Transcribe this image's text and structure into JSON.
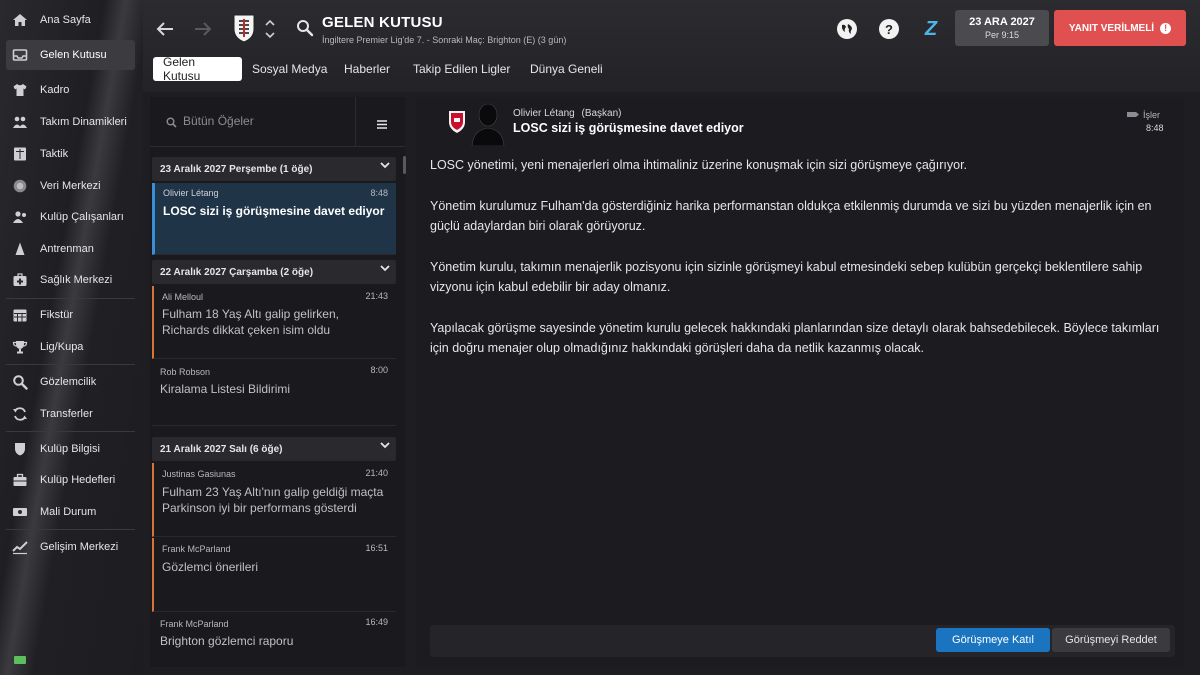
{
  "sidebar": {
    "items": [
      {
        "label": "Ana Sayfa",
        "icon": "home-icon"
      },
      {
        "label": "Gelen Kutusu",
        "icon": "inbox-icon"
      },
      {
        "label": "Kadro",
        "icon": "shirt-icon"
      },
      {
        "label": "Takım Dinamikleri",
        "icon": "team-dynamics-icon"
      },
      {
        "label": "Taktik",
        "icon": "tactics-board-icon"
      },
      {
        "label": "Veri Merkezi",
        "icon": "data-hub-icon"
      },
      {
        "label": "Kulüp Çalışanları",
        "icon": "staff-icon"
      },
      {
        "label": "Antrenman",
        "icon": "training-icon"
      },
      {
        "label": "Sağlık Merkezi",
        "icon": "medical-icon"
      },
      {
        "label": "Fikstür",
        "icon": "calendar-icon"
      },
      {
        "label": "Lig/Kupa",
        "icon": "trophy-icon"
      },
      {
        "label": "Gözlemcilik",
        "icon": "scouting-icon"
      },
      {
        "label": "Transferler",
        "icon": "transfer-icon"
      },
      {
        "label": "Kulüp Bilgisi",
        "icon": "club-shield-icon"
      },
      {
        "label": "Kulüp Hedefleri",
        "icon": "briefcase-icon"
      },
      {
        "label": "Mali Durum",
        "icon": "finance-icon"
      },
      {
        "label": "Gelişim Merkezi",
        "icon": "development-icon"
      }
    ]
  },
  "header": {
    "title": "GELEN KUTUSU",
    "subtitle": "İngiltere Premier Lig'de 7. - Sonraki Maç: Brighton (E) (3 gün)",
    "date": "23 ARA 2027",
    "day_time": "Per 9:15",
    "reply_label": "YANIT VERİLMELİ",
    "help_glyph": "?",
    "z_glyph": "Z"
  },
  "tabs": [
    {
      "label": "Gelen Kutusu",
      "active": true
    },
    {
      "label": "Sosyal Medya"
    },
    {
      "label": "Haberler"
    },
    {
      "label": "Takip Edilen Ligler"
    },
    {
      "label": "Dünya Geneli"
    }
  ],
  "search": {
    "placeholder": "Bütün Öğeler"
  },
  "groups": [
    {
      "title": "23 Aralık 2027 Perşembe (1 öğe)"
    },
    {
      "title": "22 Aralık 2027 Çarşamba (2 öğe)"
    },
    {
      "title": "21 Aralık 2027 Salı (6 öğe)"
    }
  ],
  "messages": [
    {
      "sender": "Olivier Létang",
      "time": "8:48",
      "subject": "LOSC sizi iş görüşmesine davet ediyor"
    },
    {
      "sender": "Ali Melloul",
      "time": "21:43",
      "subject": "Fulham 18 Yaş Altı galip gelirken, Richards dikkat çeken isim oldu"
    },
    {
      "sender": "Rob Robson",
      "time": "8:00",
      "subject": "Kiralama Listesi Bildirimi"
    },
    {
      "sender": "Justinas Gasiunas",
      "time": "21:40",
      "subject": "Fulham 23 Yaş Altı'nın galip geldiği maçta Parkinson iyi bir performans gösterdi"
    },
    {
      "sender": "Frank McParland",
      "time": "16:51",
      "subject": "Gözlemci önerileri"
    },
    {
      "sender": "Frank McParland",
      "time": "16:49",
      "subject": "Brighton gözlemci raporu"
    }
  ],
  "detail": {
    "sender": "Olivier Létang",
    "role": "(Başkan)",
    "subject": "LOSC sizi iş görüşmesine davet ediyor",
    "tag": "İşler",
    "time": "8:48",
    "paragraphs": [
      "LOSC yönetimi, yeni menajerleri olma ihtimaliniz üzerine konuşmak için sizi görüşmeye çağırıyor.",
      "Yönetim kurulumuz Fulham'da gösterdiğiniz harika performanstan oldukça etkilenmiş durumda ve sizi bu yüzden menajerlik için en güçlü adaylardan biri olarak görüyoruz.",
      "Yönetim kurulu, takımın menajerlik pozisyonu için sizinle görüşmeyi kabul etmesindeki sebep kulübün gerçekçi beklentilere sahip vizyonu için kabul edebilir bir aday olmanız.",
      "Yapılacak görüşme sayesinde yönetim kurulu gelecek hakkındaki planlarından size detaylı olarak bahsedebilecek. Böylece takımları için doğru menajer olup olmadığınız hakkındaki görüşleri daha da netlik kazanmış olacak."
    ],
    "accept_label": "Görüşmeye Katıl",
    "decline_label": "Görüşmeyi Reddet"
  },
  "colors": {
    "accent_blue": "#1a74c0",
    "alert_red": "#e05050",
    "unread_orange": "#d9733a",
    "selected_bg": "#203448"
  }
}
